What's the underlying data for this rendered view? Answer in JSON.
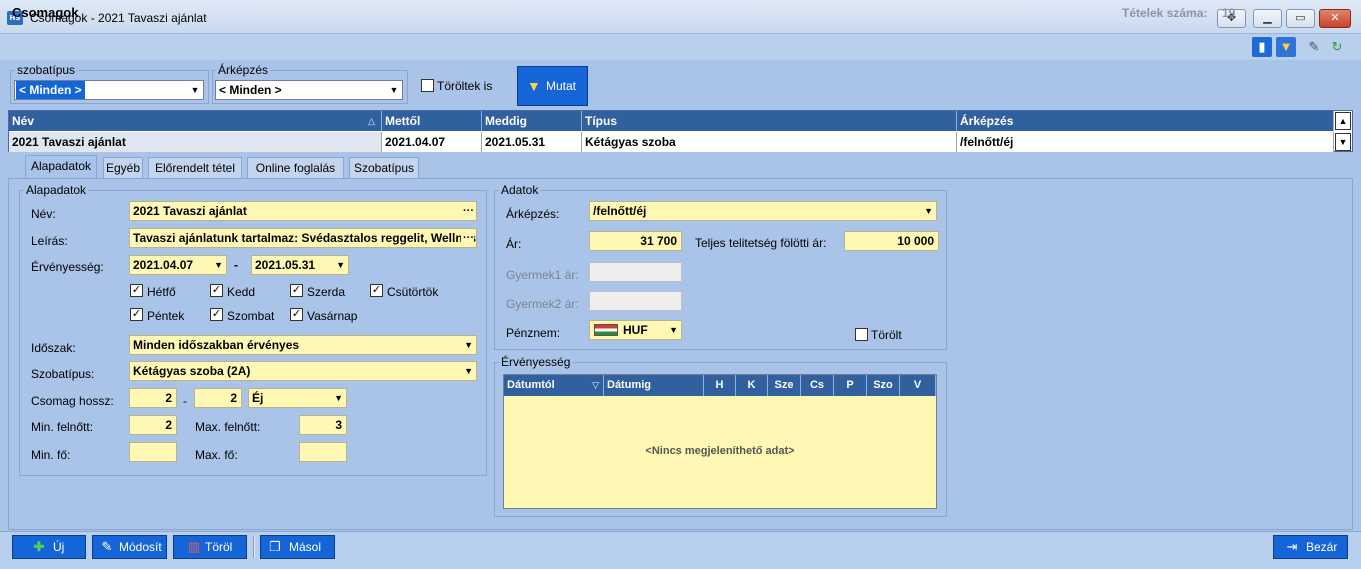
{
  "window": {
    "title": "Csomagok - 2021 Tavaszi ajánlat",
    "icon_text": "HS"
  },
  "header": {
    "title": "Csomagok",
    "count_label": "Tételek száma:",
    "count_value": "19"
  },
  "filters": {
    "room_type": {
      "label": "szobatípus",
      "value": "< Minden >"
    },
    "pricing": {
      "label": "Árképzés",
      "value": "< Minden >"
    },
    "deleted_too": {
      "label": "Töröltek is",
      "checked": false
    },
    "show_button": "Mutat"
  },
  "grid": {
    "columns": [
      "Név",
      "Mettől",
      "Meddig",
      "Típus",
      "Árképzés"
    ],
    "rows": [
      [
        "2021 Tavaszi ajánlat",
        "2021.04.07",
        "2021.05.31",
        "Kétágyas szoba",
        "/felnőtt/éj"
      ]
    ]
  },
  "tabs": [
    "Alapadatok",
    "Egyéb",
    "Előrendelt tétel",
    "Online foglalás",
    "Szobatípus"
  ],
  "basic": {
    "group_label": "Alapadatok",
    "name_label": "Név:",
    "name_value": "2021 Tavaszi ajánlat",
    "desc_label": "Leírás:",
    "desc_value": "Tavaszi ajánlatunk tartalmaz: Svédasztalos reggelit, Wellness",
    "validity_label": "Érvényesség:",
    "from": "2021.04.07",
    "dash": "-",
    "to": "2021.05.31",
    "days": [
      {
        "label": "Hétfő",
        "checked": true
      },
      {
        "label": "Kedd",
        "checked": true
      },
      {
        "label": "Szerda",
        "checked": true
      },
      {
        "label": "Csütörtök",
        "checked": true
      },
      {
        "label": "Péntek",
        "checked": true
      },
      {
        "label": "Szombat",
        "checked": true
      },
      {
        "label": "Vasárnap",
        "checked": true
      }
    ],
    "period_label": "Időszak:",
    "period_value": "Minden időszakban érvényes",
    "roomtype_label": "Szobatípus:",
    "roomtype_value": "Kétágyas szoba (2A)",
    "length_label": "Csomag hossz:",
    "length_from": "2",
    "length_dash": "-",
    "length_to": "2",
    "length_unit": "Éj",
    "min_adult_label": "Min. felnőtt:",
    "min_adult": "2",
    "max_adult_label": "Max. felnőtt:",
    "max_adult": "3",
    "min_person_label": "Min. fő:",
    "min_person": "",
    "max_person_label": "Max. fő:",
    "max_person": ""
  },
  "data": {
    "group_label": "Adatok",
    "pricing_label": "Árképzés:",
    "pricing_value": "/felnőtt/éj",
    "price_label": "Ár:",
    "price_value": "31 700",
    "full_price_label": "Teljes telitetség fölötti ár:",
    "full_price_value": "10 000",
    "child1_label": "Gyermek1 ár:",
    "child2_label": "Gyermek2 ár:",
    "currency_label": "Pénznem:",
    "currency_value": "HUF",
    "deleted_label": "Törölt"
  },
  "validity": {
    "group_label": "Érvényesség",
    "columns": [
      "Dátumtól",
      "Dátumig",
      "H",
      "K",
      "Sze",
      "Cs",
      "P",
      "Szo",
      "V"
    ],
    "empty_text": "<Nincs megjeleníthető adat>"
  },
  "actions": {
    "new": "Új",
    "edit": "Módosít",
    "delete": "Töröl",
    "copy": "Másol",
    "close": "Bezár"
  },
  "colors": {
    "accent": "#1565d8",
    "background": "#a9c3e9",
    "field": "#fff8b5",
    "grid_header": "#31609e"
  }
}
